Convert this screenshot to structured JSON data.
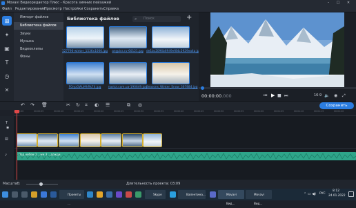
{
  "window": {
    "title": "Movavi Видеоредактор Плюс - Красота зимних пейзажей"
  },
  "menu": [
    "Файл",
    "Редактирование",
    "Просмотр",
    "Настройки",
    "Сохранить",
    "Справка"
  ],
  "nav": {
    "items": [
      "Импорт файлов",
      "Библиотека файлов",
      "Звуки",
      "Музыка",
      "Видеоклипы",
      "Фоны"
    ],
    "active_index": 1
  },
  "library": {
    "title": "Библиотека файлов",
    "search_placeholder": "Поиск",
    "add_label": "+",
    "files": [
      {
        "caption": "127796-winter_1536x1000.jpg"
      },
      {
        "caption": "anypics.ru-60121.jpg"
      },
      {
        "caption": "de1bc2096b6949ef84c5929ea4a.jpg"
      },
      {
        "caption": "FOnpGWuMhRk74.jpg"
      },
      {
        "caption": "nastol.com.ua-190649.jpg"
      },
      {
        "caption": "Seasons_Winter_Snow_367884.jpg"
      }
    ]
  },
  "preview": {
    "timecode": "00:00:00",
    "timecode_ms": ".000",
    "aspect": "16:9"
  },
  "edit": {
    "save_label": "Сохранить"
  },
  "ruler": {
    "ticks": [
      "00:00:00",
      "00:00:05",
      "00:00:10",
      "00:00:15",
      "00:00:20",
      "00:00:25",
      "00:00:30",
      "00:00:35",
      "00:00:40",
      "00:00:45",
      "00:00:50",
      "00:00:55",
      "00:01:00",
      "00:01:05",
      "00:01:10",
      "00:01:15",
      "00:01:20"
    ]
  },
  "timeline": {
    "audio_label": "Под небом 3 ...мм 3 ...дожди"
  },
  "status": {
    "scale_label": "Масштаб:",
    "duration_label": "Длительность проекта: 03:09"
  },
  "taskbar": {
    "buttons": [
      "Проекты ...",
      "Skype",
      "Валентина...",
      "Movavi Вид...",
      "Movavi Вид..."
    ],
    "lang": "РУС",
    "time": "8:12",
    "date": "24.01.2022"
  },
  "colors": {
    "accent": "#2b7de0",
    "clip_border": "#d6b02e",
    "audio": "#2ea58a"
  }
}
